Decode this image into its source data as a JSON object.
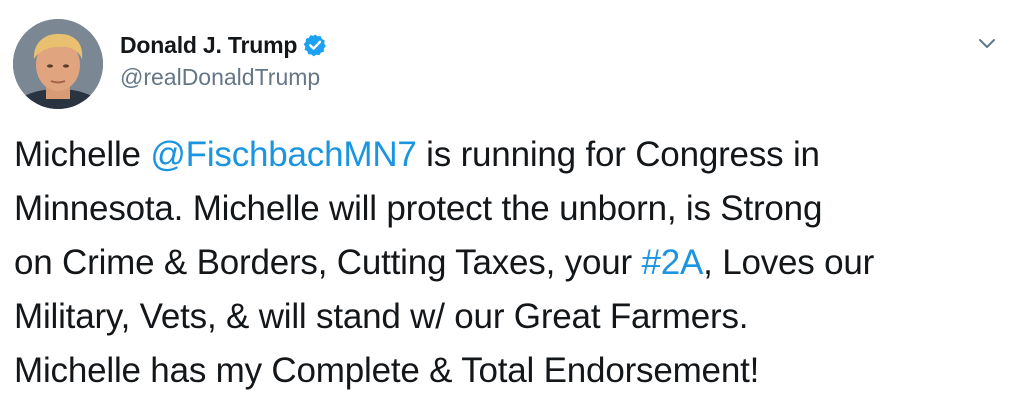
{
  "author": {
    "display_name": "Donald J. Trump",
    "handle": "@realDonaldTrump",
    "verified": true,
    "avatar_icon": "profile-photo",
    "verified_icon": "verified-badge-icon",
    "menu_icon": "chevron-down-icon"
  },
  "colors": {
    "link": "#1b95e0",
    "verified_badge": "#1da1f2",
    "handle": "#657786",
    "text": "#14171a"
  },
  "tweet": {
    "lines": [
      {
        "pre": "Michelle ",
        "link": "@FischbachMN7",
        "post": " is running for Congress in"
      },
      {
        "text": "Minnesota. Michelle will protect the unborn, is Strong"
      },
      {
        "pre": "on Crime & Borders, Cutting Taxes, your ",
        "link": "#2A",
        "post": ", Loves our"
      },
      {
        "text": "Military, Vets, & will stand w/ our Great Farmers."
      },
      {
        "text": "Michelle has my Complete & Total Endorsement!"
      }
    ]
  }
}
